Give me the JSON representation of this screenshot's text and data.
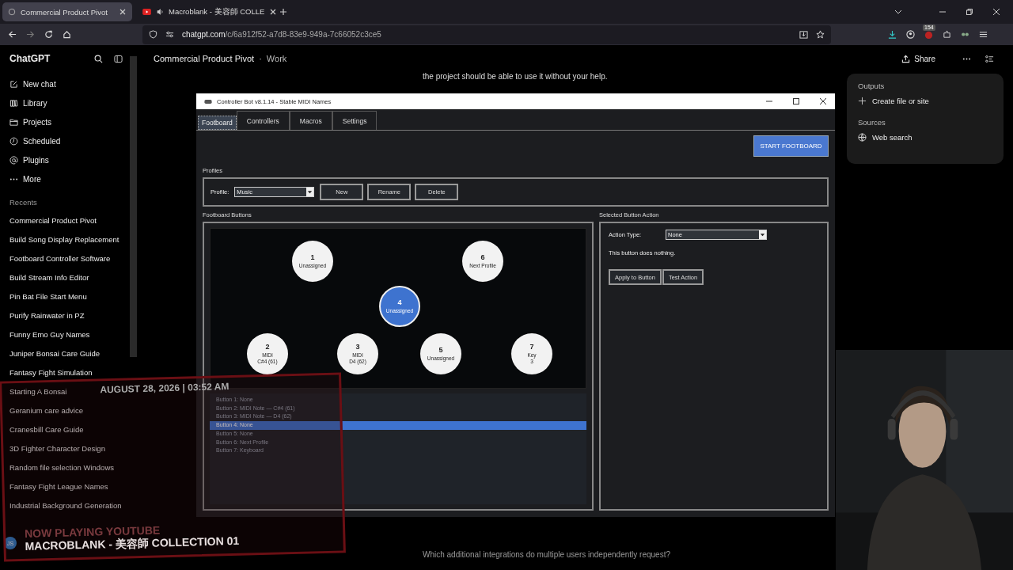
{
  "browser": {
    "tabs": [
      {
        "title": "Commercial Product Pivot",
        "selected": true,
        "kind": "chat"
      },
      {
        "title": "Macroblank - 美容師 COLLE",
        "selected": false,
        "kind": "video"
      }
    ],
    "url_host": "chatgpt.com",
    "url_path": "/c/6a912f52-a7d8-83e9-949a-7c66052c3ce5",
    "extension_badge": "154"
  },
  "sidebar": {
    "brand": "ChatGPT",
    "nav": [
      {
        "label": "New chat",
        "kind": "compose"
      },
      {
        "label": "Library",
        "kind": "library"
      },
      {
        "label": "Projects",
        "kind": "folder"
      },
      {
        "label": "Scheduled",
        "kind": "clock"
      },
      {
        "label": "Plugins",
        "kind": "at"
      },
      {
        "label": "More",
        "kind": "dots"
      }
    ],
    "recents_title": "Recents",
    "recents": [
      "Commercial Product Pivot",
      "Build Song Display Replacement",
      "Footboard Controller Software",
      "Build Stream Info Editor",
      "Pin Bat File Start Menu",
      "Purify Rainwater in PZ",
      "Funny Emo Guy Names",
      "Juniper Bonsai Care Guide",
      "Fantasy Fight Simulation",
      "Starting A Bonsai",
      "Geranium care advice",
      "Cranesbill Care Guide",
      "3D Fighter Character Design",
      "Random file selection Windows",
      "Fantasy Fight League Names",
      "Industrial Background Generation"
    ],
    "user_initials": "JS"
  },
  "header": {
    "title": "Commercial Product Pivot",
    "separator": "·",
    "project": "Work",
    "share": "Share"
  },
  "chat_lines": [
    "the project should be able to use it without your help.",
    "Which additional integrations do multiple users independently request?"
  ],
  "right_panel": {
    "outputs_title": "Outputs",
    "create": "Create file or site",
    "sources_title": "Sources",
    "source": "Web search"
  },
  "app": {
    "title": "Controller Bot v8.1.14 - Stable MIDI Names",
    "tabs": [
      {
        "label": "Footboard",
        "selected": true
      },
      {
        "label": "Controllers",
        "selected": false
      },
      {
        "label": "Macros",
        "selected": false
      },
      {
        "label": "Settings",
        "selected": false
      }
    ],
    "start": "START FOOTBOARD",
    "profiles_title": "Profiles",
    "profile_label": "Profile:",
    "profile_value": "Music",
    "profile_buttons": [
      "New",
      "Rename",
      "Delete"
    ],
    "footboard_title": "Footboard Buttons",
    "pads": [
      {
        "number": "1",
        "lines": [
          "Unassigned"
        ],
        "selected": false
      },
      {
        "number": "6",
        "lines": [
          "Next Profile"
        ],
        "selected": false
      },
      {
        "number": "4",
        "lines": [
          "Unassigned"
        ],
        "selected": true
      },
      {
        "number": "2",
        "lines": [
          "MIDI",
          "C#4 (61)"
        ],
        "selected": false
      },
      {
        "number": "3",
        "lines": [
          "MIDI",
          "D4 (62)"
        ],
        "selected": false
      },
      {
        "number": "5",
        "lines": [
          "Unassigned"
        ],
        "selected": false
      },
      {
        "number": "7",
        "lines": [
          "Key",
          "3"
        ],
        "selected": false
      }
    ],
    "list": [
      {
        "text": "Button 1: None",
        "selected": false
      },
      {
        "text": "Button 2: MIDI Note — C#4 (61)",
        "selected": false
      },
      {
        "text": "Button 3: MIDI Note — D4 (62)",
        "selected": false
      },
      {
        "text": "Button 4: None",
        "selected": true
      },
      {
        "text": "Button 5: None",
        "selected": false
      },
      {
        "text": "Button 6: Next Profile",
        "selected": false
      },
      {
        "text": "Button 7: Keyboard",
        "selected": false
      }
    ],
    "action_title": "Selected Button Action",
    "action_label": "Action Type:",
    "action_value": "None",
    "action_note": "This button does nothing.",
    "action_buttons": [
      "Apply to Button",
      "Test Action"
    ]
  },
  "overlay": {
    "date": "AUGUST 28, 2026 | 03:52 AM",
    "now_playing": "NOW PLAYING YOUTUBE",
    "track": "MACROBLANK - 美容師 COLLECTION 01"
  },
  "webcam": {
    "kind": "picture"
  }
}
